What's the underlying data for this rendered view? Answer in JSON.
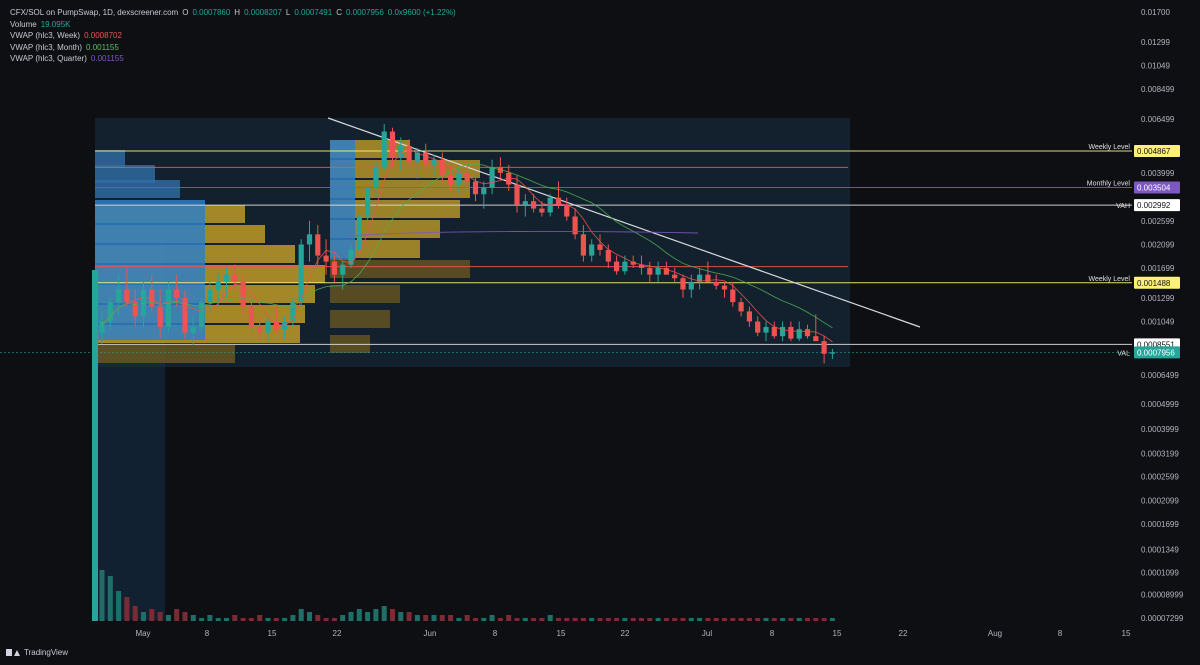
{
  "legend": {
    "pair": "CFX/SOL on PumpSwap, 1D, dexscreener.com",
    "open_label": "O",
    "open": "0.0007860",
    "high_label": "H",
    "high": "0.0008207",
    "low_label": "L",
    "low": "0.0007491",
    "close_label": "C",
    "close": "0.0007956",
    "change": "0.0x9600 (+1.22%)",
    "volume_label": "Volume",
    "volume_value": "19.095K",
    "vwap_week_label": "VWAP (hlc3, Week)",
    "vwap_week_value": "0.0008702",
    "vwap_month_label": "VWAP (hlc3, Month)",
    "vwap_month_value": "0.001155",
    "vwap_quarter_label": "VWAP (hlc3, Quarter)",
    "vwap_quarter_value": "0.001155"
  },
  "branding": {
    "name": "TradingView"
  },
  "colors": {
    "background": "#0e0f13",
    "up": "#26a69a",
    "down": "#ef5350",
    "vwap_week": "#ef5350",
    "vwap_month": "#4caf50",
    "vwap_quarter": "#7e57c2",
    "weekly_level": "#fff176",
    "monthly_level": "#7e57c2",
    "volume_profile_blue": "#2f7fc7",
    "volume_profile_gold": "#c9a227"
  },
  "chart_data": {
    "type": "candlestick",
    "title": "CFX/SOL on PumpSwap, 1D, dexscreener.com",
    "y_scale": "log",
    "y_ticks": [
      "0.01700",
      "0.01299",
      "0.01049",
      "0.008499",
      "0.006499",
      "0.003999",
      "0.002599",
      "0.002099",
      "0.001699",
      "0.001299",
      "0.001049",
      "0.0006499",
      "0.0004999",
      "0.0003999",
      "0.0003199",
      "0.0002599",
      "0.0002099",
      "0.0001699",
      "0.0001349",
      "0.0001099",
      "0.00008999",
      "0.00007299"
    ],
    "x_ticks": [
      "May",
      "8",
      "15",
      "22",
      "Jun",
      "8",
      "15",
      "22",
      "Jul",
      "8",
      "15",
      "22",
      "Aug",
      "8",
      "15"
    ],
    "levels": [
      {
        "label": "Weekly Level",
        "value": "0.004867",
        "kind": "weekly"
      },
      {
        "label": "Monthly Level",
        "value": "0.003504",
        "kind": "monthly"
      },
      {
        "label": "VAH",
        "value": "0.002992",
        "kind": "vah"
      },
      {
        "label": "Weekly Level",
        "value": "0.001488",
        "kind": "weekly"
      },
      {
        "label": "",
        "value": "0.0008551",
        "kind": "plain"
      },
      {
        "label": "VAL",
        "value": "0.0007956",
        "kind": "last"
      }
    ],
    "red_lines": [
      0.0042,
      0.00172
    ],
    "candles": [
      [
        0.00095,
        0.00115,
        0.00086,
        0.00105
      ],
      [
        0.00105,
        0.0013,
        0.00098,
        0.00125
      ],
      [
        0.00125,
        0.0016,
        0.0011,
        0.0014
      ],
      [
        0.0014,
        0.0017,
        0.0012,
        0.00125
      ],
      [
        0.00125,
        0.0014,
        0.001,
        0.0011
      ],
      [
        0.0011,
        0.0015,
        0.001,
        0.0014
      ],
      [
        0.0014,
        0.0016,
        0.00115,
        0.0012
      ],
      [
        0.0012,
        0.0014,
        0.0009,
        0.001
      ],
      [
        0.001,
        0.0015,
        0.00095,
        0.0014
      ],
      [
        0.0014,
        0.0016,
        0.0012,
        0.0013
      ],
      [
        0.0013,
        0.0014,
        0.0009,
        0.00095
      ],
      [
        0.00095,
        0.0011,
        0.00085,
        0.001
      ],
      [
        0.001,
        0.0013,
        0.00095,
        0.00125
      ],
      [
        0.00125,
        0.0015,
        0.00115,
        0.0014
      ],
      [
        0.0014,
        0.0016,
        0.0012,
        0.0015
      ],
      [
        0.0015,
        0.0017,
        0.0013,
        0.0016
      ],
      [
        0.0016,
        0.00175,
        0.0014,
        0.0015
      ],
      [
        0.0015,
        0.0016,
        0.0011,
        0.0012
      ],
      [
        0.0012,
        0.0013,
        0.00095,
        0.001
      ],
      [
        0.001,
        0.0011,
        0.00088,
        0.00095
      ],
      [
        0.00095,
        0.0011,
        0.00088,
        0.00105
      ],
      [
        0.00105,
        0.0012,
        0.00095,
        0.00098
      ],
      [
        0.00098,
        0.0011,
        0.0009,
        0.00105
      ],
      [
        0.00105,
        0.0013,
        0.001,
        0.00125
      ],
      [
        0.00125,
        0.0022,
        0.0012,
        0.0021
      ],
      [
        0.0021,
        0.0026,
        0.0018,
        0.0023
      ],
      [
        0.0023,
        0.0025,
        0.0017,
        0.0019
      ],
      [
        0.0019,
        0.0022,
        0.0016,
        0.0018
      ],
      [
        0.0018,
        0.0019,
        0.0015,
        0.0016
      ],
      [
        0.0016,
        0.0018,
        0.0014,
        0.00175
      ],
      [
        0.00175,
        0.0021,
        0.0017,
        0.002
      ],
      [
        0.002,
        0.0028,
        0.0019,
        0.0027
      ],
      [
        0.0027,
        0.0036,
        0.0026,
        0.0035
      ],
      [
        0.0035,
        0.0044,
        0.0032,
        0.0042
      ],
      [
        0.0042,
        0.0062,
        0.0041,
        0.0058
      ],
      [
        0.0058,
        0.006,
        0.0042,
        0.0046
      ],
      [
        0.0046,
        0.0055,
        0.0041,
        0.0051
      ],
      [
        0.0051,
        0.0054,
        0.0042,
        0.0044
      ],
      [
        0.0044,
        0.005,
        0.0038,
        0.0048
      ],
      [
        0.0048,
        0.0052,
        0.0041,
        0.0043
      ],
      [
        0.0043,
        0.0047,
        0.0039,
        0.0045
      ],
      [
        0.0045,
        0.0048,
        0.0037,
        0.0039
      ],
      [
        0.0039,
        0.0043,
        0.0034,
        0.0036
      ],
      [
        0.0036,
        0.0042,
        0.0033,
        0.004
      ],
      [
        0.004,
        0.0044,
        0.0035,
        0.0037
      ],
      [
        0.0037,
        0.0039,
        0.0031,
        0.0033
      ],
      [
        0.0033,
        0.0037,
        0.0029,
        0.0035
      ],
      [
        0.0035,
        0.0045,
        0.0033,
        0.0042
      ],
      [
        0.0042,
        0.0046,
        0.0038,
        0.004
      ],
      [
        0.004,
        0.0043,
        0.0034,
        0.0036
      ],
      [
        0.0036,
        0.0039,
        0.0028,
        0.003
      ],
      [
        0.003,
        0.0033,
        0.0027,
        0.0031
      ],
      [
        0.0031,
        0.0033,
        0.0028,
        0.0029
      ],
      [
        0.0029,
        0.0031,
        0.0027,
        0.0028
      ],
      [
        0.0028,
        0.0033,
        0.0027,
        0.0032
      ],
      [
        0.0032,
        0.0037,
        0.0029,
        0.003
      ],
      [
        0.003,
        0.0032,
        0.0026,
        0.0027
      ],
      [
        0.0027,
        0.0029,
        0.0022,
        0.0023
      ],
      [
        0.0023,
        0.0025,
        0.0018,
        0.0019
      ],
      [
        0.0019,
        0.0022,
        0.0018,
        0.0021
      ],
      [
        0.0021,
        0.0023,
        0.0019,
        0.002
      ],
      [
        0.002,
        0.0021,
        0.0017,
        0.0018
      ],
      [
        0.0018,
        0.0019,
        0.0016,
        0.00165
      ],
      [
        0.00165,
        0.0019,
        0.0016,
        0.0018
      ],
      [
        0.0018,
        0.0019,
        0.0017,
        0.00175
      ],
      [
        0.00175,
        0.0019,
        0.0016,
        0.0017
      ],
      [
        0.0017,
        0.0018,
        0.0015,
        0.0016
      ],
      [
        0.0016,
        0.0018,
        0.0015,
        0.0017
      ],
      [
        0.0017,
        0.0018,
        0.0016,
        0.0016
      ],
      [
        0.0016,
        0.0017,
        0.0015,
        0.00155
      ],
      [
        0.00155,
        0.0016,
        0.0013,
        0.0014
      ],
      [
        0.0014,
        0.0016,
        0.0013,
        0.0015
      ],
      [
        0.0015,
        0.0017,
        0.0014,
        0.0016
      ],
      [
        0.0016,
        0.0018,
        0.0015,
        0.0015
      ],
      [
        0.0015,
        0.0016,
        0.0014,
        0.00145
      ],
      [
        0.00145,
        0.0015,
        0.0013,
        0.0014
      ],
      [
        0.0014,
        0.0015,
        0.0012,
        0.00125
      ],
      [
        0.00125,
        0.0013,
        0.0011,
        0.00115
      ],
      [
        0.00115,
        0.0012,
        0.001,
        0.00105
      ],
      [
        0.00105,
        0.0011,
        0.00092,
        0.00095
      ],
      [
        0.00095,
        0.00105,
        0.00088,
        0.001
      ],
      [
        0.001,
        0.00105,
        0.0009,
        0.00092
      ],
      [
        0.00092,
        0.00105,
        0.00088,
        0.001
      ],
      [
        0.001,
        0.00105,
        0.00088,
        0.0009
      ],
      [
        0.0009,
        0.00105,
        0.00088,
        0.00098
      ],
      [
        0.00098,
        0.00102,
        0.0009,
        0.00092
      ],
      [
        0.00092,
        0.00112,
        0.00088,
        0.00088
      ],
      [
        0.00088,
        0.00092,
        0.00072,
        0.000786
      ],
      [
        0.000786,
        0.0008207,
        0.0007491,
        0.0007956
      ]
    ],
    "volume": [
      17,
      15,
      10,
      8,
      5,
      3,
      4,
      3,
      2,
      4,
      3,
      2,
      1,
      2,
      1,
      1,
      2,
      1,
      1,
      2,
      1,
      1,
      1,
      2,
      4,
      3,
      2,
      1,
      1,
      2,
      3,
      4,
      3,
      4,
      5,
      4,
      3,
      3,
      2,
      2,
      2,
      2,
      2,
      1,
      2,
      1,
      1,
      2,
      1,
      2,
      1,
      1,
      1,
      1,
      2,
      1,
      1,
      1,
      1,
      1,
      1,
      1,
      1,
      1,
      1,
      1,
      1,
      1,
      1,
      1,
      1,
      1,
      1,
      1,
      1,
      1,
      1,
      1,
      1,
      1,
      1,
      1,
      1,
      1,
      1,
      1,
      1,
      1,
      1
    ]
  }
}
